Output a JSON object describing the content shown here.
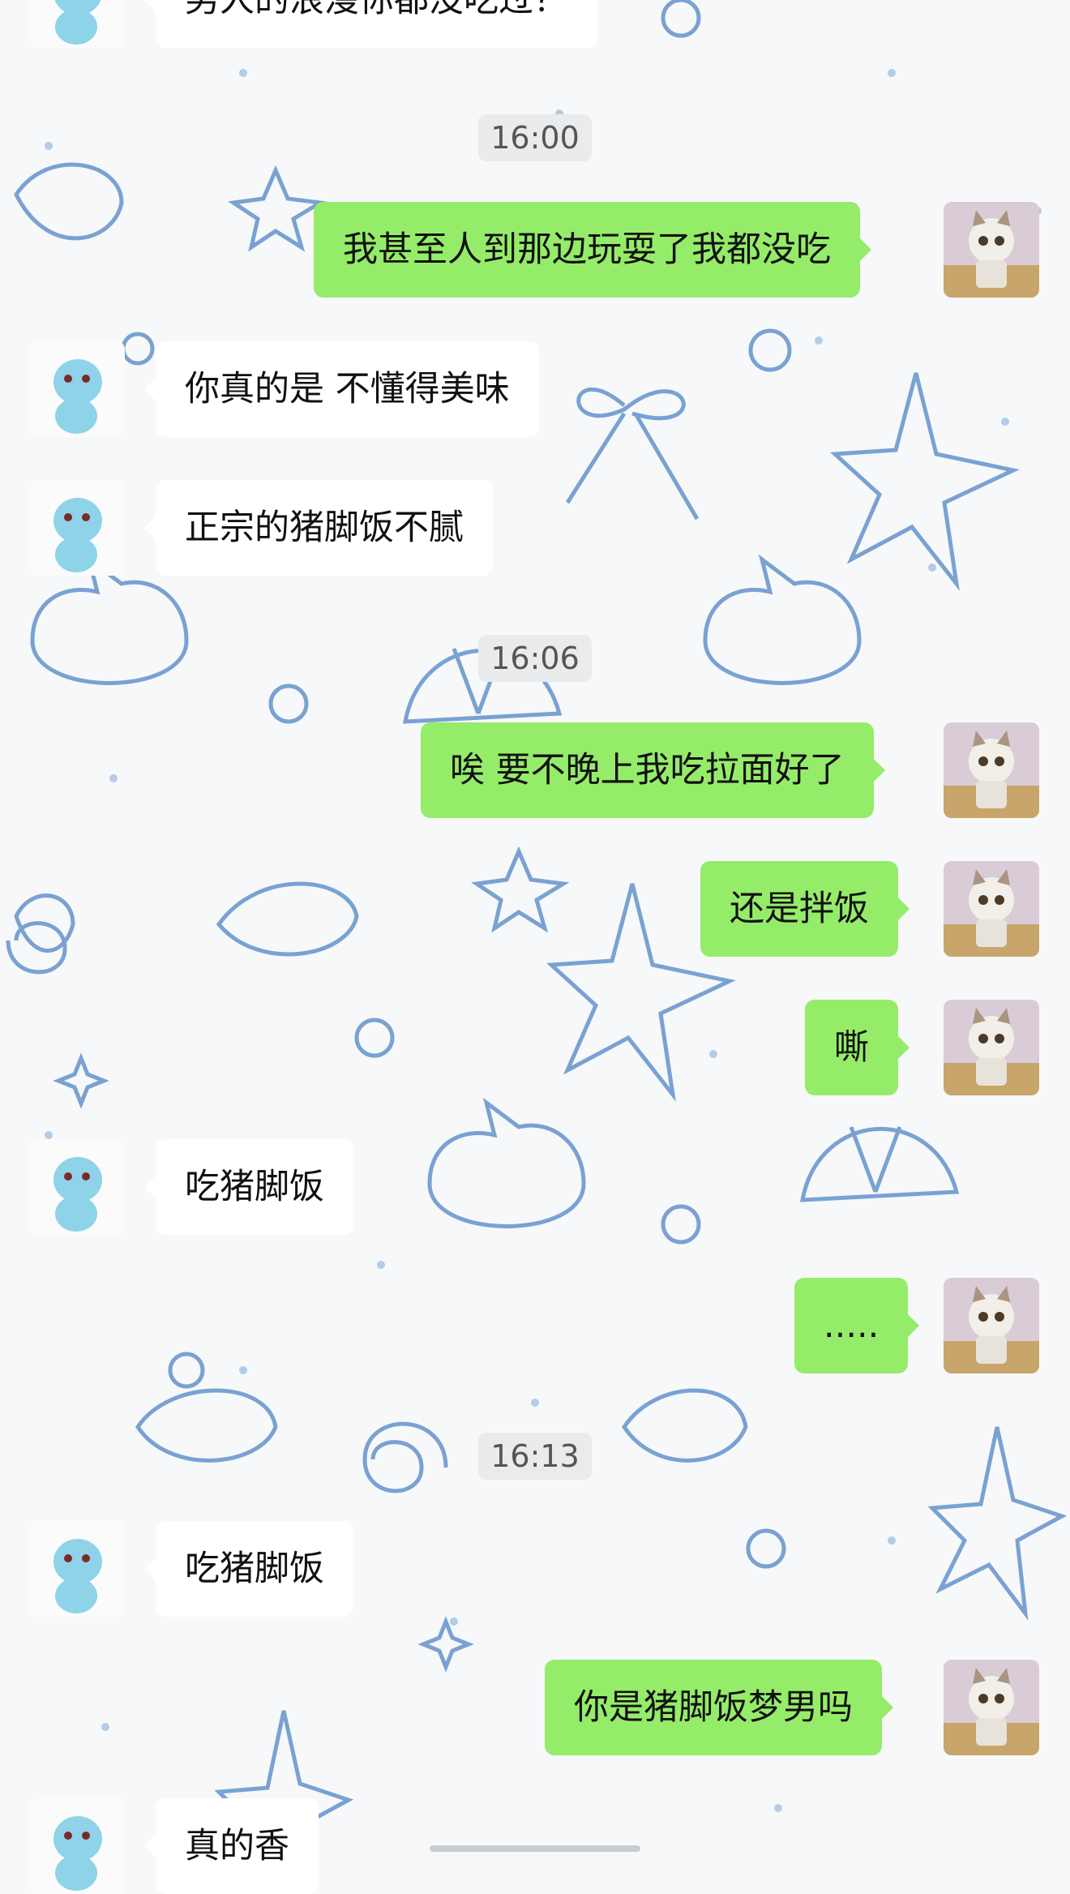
{
  "chat": {
    "messages": [
      {
        "side": "left",
        "text": "男人的浪漫你都没吃过？"
      },
      {
        "side": "right",
        "text": "我甚至人到那边玩耍了我都没吃"
      },
      {
        "side": "left",
        "text": "你真的是 不懂得美味"
      },
      {
        "side": "left",
        "text": "正宗的猪脚饭不腻"
      },
      {
        "side": "right",
        "text": "唉 要不晚上我吃拉面好了"
      },
      {
        "side": "right",
        "text": "还是拌饭"
      },
      {
        "side": "right",
        "text": "嘶"
      },
      {
        "side": "left",
        "text": "吃猪脚饭"
      },
      {
        "side": "right",
        "text": "....."
      },
      {
        "side": "left",
        "text": "吃猪脚饭"
      },
      {
        "side": "right",
        "text": "你是猪脚饭梦男吗"
      },
      {
        "side": "left",
        "text": "真的香"
      }
    ],
    "timestamps": [
      "16:00",
      "16:06",
      "16:13"
    ]
  },
  "theme": {
    "bubble_right_color": "#95ec69",
    "bubble_left_color": "#ffffff",
    "background_color": "#f7f8f9",
    "pattern_color": "#4f86c6",
    "left_avatar_icon": "squirtle-avatar-icon",
    "right_avatar_icon": "kitten-avatar-icon"
  }
}
